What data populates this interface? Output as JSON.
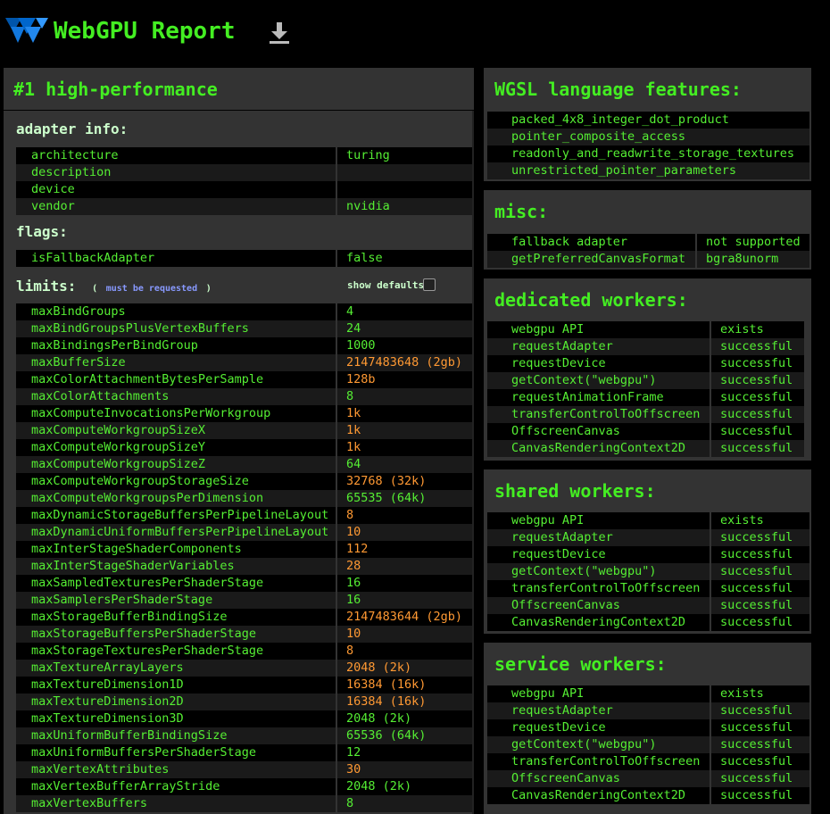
{
  "header": {
    "title": "WebGPU Report"
  },
  "adapter_panel": {
    "title": "#1 high-performance",
    "adapter_info": {
      "heading": "adapter info:",
      "rows": [
        {
          "k": "architecture",
          "v": "turing"
        },
        {
          "k": "description",
          "v": ""
        },
        {
          "k": "device",
          "v": ""
        },
        {
          "k": "vendor",
          "v": "nvidia"
        }
      ]
    },
    "flags": {
      "heading": "flags:",
      "rows": [
        {
          "k": "isFallbackAdapter",
          "v": "false"
        }
      ]
    },
    "limits": {
      "heading": "limits:",
      "paren_open": "(",
      "must_be_requested": "must be requested",
      "paren_close": ")",
      "show_defaults": "show defaults",
      "rows": [
        {
          "k": "maxBindGroups",
          "v": "4",
          "highlight": false
        },
        {
          "k": "maxBindGroupsPlusVertexBuffers",
          "v": "24",
          "highlight": false
        },
        {
          "k": "maxBindingsPerBindGroup",
          "v": "1000",
          "highlight": false
        },
        {
          "k": "maxBufferSize",
          "v": "2147483648 (2gb)",
          "highlight": true
        },
        {
          "k": "maxColorAttachmentBytesPerSample",
          "v": "128b",
          "highlight": true
        },
        {
          "k": "maxColorAttachments",
          "v": "8",
          "highlight": false
        },
        {
          "k": "maxComputeInvocationsPerWorkgroup",
          "v": "1k",
          "highlight": true
        },
        {
          "k": "maxComputeWorkgroupSizeX",
          "v": "1k",
          "highlight": true
        },
        {
          "k": "maxComputeWorkgroupSizeY",
          "v": "1k",
          "highlight": true
        },
        {
          "k": "maxComputeWorkgroupSizeZ",
          "v": "64",
          "highlight": false
        },
        {
          "k": "maxComputeWorkgroupStorageSize",
          "v": "32768 (32k)",
          "highlight": true
        },
        {
          "k": "maxComputeWorkgroupsPerDimension",
          "v": "65535 (64k)",
          "highlight": false
        },
        {
          "k": "maxDynamicStorageBuffersPerPipelineLayout",
          "v": "8",
          "highlight": true
        },
        {
          "k": "maxDynamicUniformBuffersPerPipelineLayout",
          "v": "10",
          "highlight": true
        },
        {
          "k": "maxInterStageShaderComponents",
          "v": "112",
          "highlight": true
        },
        {
          "k": "maxInterStageShaderVariables",
          "v": "28",
          "highlight": true
        },
        {
          "k": "maxSampledTexturesPerShaderStage",
          "v": "16",
          "highlight": false
        },
        {
          "k": "maxSamplersPerShaderStage",
          "v": "16",
          "highlight": false
        },
        {
          "k": "maxStorageBufferBindingSize",
          "v": "2147483644 (2gb)",
          "highlight": true
        },
        {
          "k": "maxStorageBuffersPerShaderStage",
          "v": "10",
          "highlight": true
        },
        {
          "k": "maxStorageTexturesPerShaderStage",
          "v": "8",
          "highlight": true
        },
        {
          "k": "maxTextureArrayLayers",
          "v": "2048 (2k)",
          "highlight": true
        },
        {
          "k": "maxTextureDimension1D",
          "v": "16384 (16k)",
          "highlight": true
        },
        {
          "k": "maxTextureDimension2D",
          "v": "16384 (16k)",
          "highlight": true
        },
        {
          "k": "maxTextureDimension3D",
          "v": "2048 (2k)",
          "highlight": false
        },
        {
          "k": "maxUniformBufferBindingSize",
          "v": "65536 (64k)",
          "highlight": false
        },
        {
          "k": "maxUniformBuffersPerShaderStage",
          "v": "12",
          "highlight": false
        },
        {
          "k": "maxVertexAttributes",
          "v": "30",
          "highlight": true
        },
        {
          "k": "maxVertexBufferArrayStride",
          "v": "2048 (2k)",
          "highlight": false
        },
        {
          "k": "maxVertexBuffers",
          "v": "8",
          "highlight": false
        }
      ]
    }
  },
  "wgsl": {
    "title": "WGSL language features:",
    "items": [
      "packed_4x8_integer_dot_product",
      "pointer_composite_access",
      "readonly_and_readwrite_storage_textures",
      "unrestricted_pointer_parameters"
    ]
  },
  "misc": {
    "title": "misc:",
    "rows": [
      {
        "k": "fallback adapter",
        "v": "not supported"
      },
      {
        "k": "getPreferredCanvasFormat",
        "v": "bgra8unorm"
      }
    ]
  },
  "dedicated": {
    "title": "dedicated workers:",
    "rows": [
      {
        "k": "webgpu API",
        "v": "exists"
      },
      {
        "k": "requestAdapter",
        "v": "successful"
      },
      {
        "k": "requestDevice",
        "v": "successful"
      },
      {
        "k": "getContext(\"webgpu\")",
        "v": "successful"
      },
      {
        "k": "requestAnimationFrame",
        "v": "successful"
      },
      {
        "k": "transferControlToOffscreen",
        "v": "successful"
      },
      {
        "k": "OffscreenCanvas",
        "v": "successful"
      },
      {
        "k": "CanvasRenderingContext2D",
        "v": "successful"
      }
    ]
  },
  "shared": {
    "title": "shared workers:",
    "rows": [
      {
        "k": "webgpu API",
        "v": "exists"
      },
      {
        "k": "requestAdapter",
        "v": "successful"
      },
      {
        "k": "requestDevice",
        "v": "successful"
      },
      {
        "k": "getContext(\"webgpu\")",
        "v": "successful"
      },
      {
        "k": "transferControlToOffscreen",
        "v": "successful"
      },
      {
        "k": "OffscreenCanvas",
        "v": "successful"
      },
      {
        "k": "CanvasRenderingContext2D",
        "v": "successful"
      }
    ]
  },
  "service": {
    "title": "service workers:",
    "rows": [
      {
        "k": "webgpu API",
        "v": "exists"
      },
      {
        "k": "requestAdapter",
        "v": "successful"
      },
      {
        "k": "requestDevice",
        "v": "successful"
      },
      {
        "k": "getContext(\"webgpu\")",
        "v": "successful"
      },
      {
        "k": "transferControlToOffscreen",
        "v": "successful"
      },
      {
        "k": "OffscreenCanvas",
        "v": "successful"
      },
      {
        "k": "CanvasRenderingContext2D",
        "v": "successful"
      }
    ]
  }
}
